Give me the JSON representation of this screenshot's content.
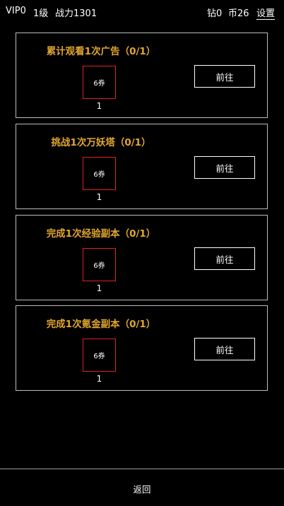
{
  "header": {
    "vip": "VIP0",
    "level": "1级",
    "power": "战力1301",
    "diamonds": "钻0",
    "coins": "币26",
    "settings_label": "设置"
  },
  "tasks": [
    {
      "title": "累计观看1次广告（0/1）",
      "reward_label": "6券",
      "reward_count": "1",
      "go_label": "前往"
    },
    {
      "title": "挑战1次万妖塔（0/1）",
      "reward_label": "6券",
      "reward_count": "1",
      "go_label": "前往"
    },
    {
      "title": "完成1次经验副本（0/1）",
      "reward_label": "6券",
      "reward_count": "1",
      "go_label": "前往"
    },
    {
      "title": "完成1次氪金副本（0/1）",
      "reward_label": "6券",
      "reward_count": "1",
      "go_label": "前往"
    }
  ],
  "footer": {
    "back_label": "返回"
  },
  "colors": {
    "background": "#000000",
    "title": "#e2a72e",
    "reward_border": "#e0221c",
    "card_border": "#bdbdbd"
  }
}
